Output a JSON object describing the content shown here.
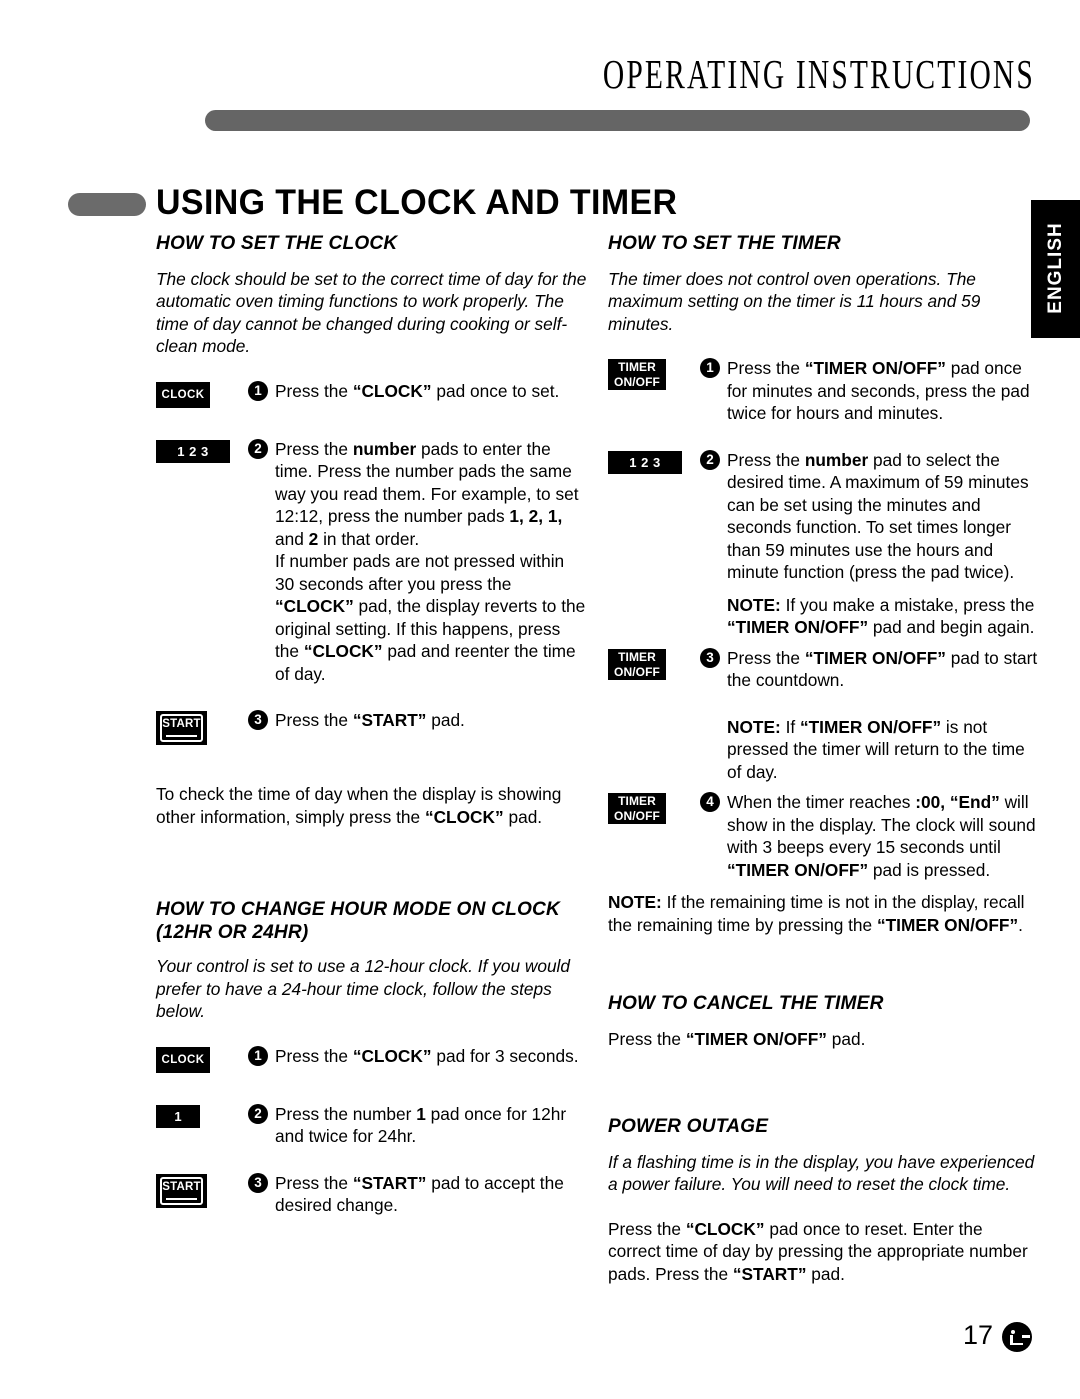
{
  "header": {
    "chapter_title": "OPERATING INSTRUCTIONS",
    "language_tab": "ENGLISH"
  },
  "section": {
    "title": "USING THE CLOCK AND TIMER"
  },
  "footer": {
    "page_number": "17",
    "logo": "lg-logo"
  },
  "left_column": {
    "clock": {
      "heading": "HOW TO SET THE CLOCK",
      "intro": "The clock should be set to the correct time of day for the automatic oven timing functions to work properly. The time of day cannot be changed during cooking or self-clean mode.",
      "steps": [
        {
          "pad": "CLOCK",
          "number": "1",
          "text_pre": "Press the ",
          "text_bold": "“CLOCK”",
          "text_post": " pad once to set."
        },
        {
          "pad": "1   2   3",
          "number": "2",
          "line1_pre": "Press the ",
          "line1_bold": "number",
          "line1_post": " pads to enter the time. Press the number pads the same way you read them. For example, to set 12:12, press the number pads ",
          "line1_bold2": "1, 2, 1,",
          "line1_post2": " and ",
          "line1_bold3": "2",
          "line1_post3": " in that order.",
          "line2_pre": "If number pads are not pressed within 30 seconds after you press the ",
          "line2_bold": "“CLOCK”",
          "line2_post": " pad, the display reverts to the original setting. If this happens, press the ",
          "line2_bold2": "“CLOCK”",
          "line2_post2": " pad and reenter the time of day."
        },
        {
          "pad": "START",
          "number": "3",
          "text_pre": "Press the ",
          "text_bold": "“START”",
          "text_post": " pad."
        }
      ],
      "check_time_pre": "To check the time of day when the display is showing other information, simply press the ",
      "check_time_bold": "“CLOCK”",
      "check_time_post": " pad."
    },
    "hour_mode": {
      "heading_line1": "HOW TO CHANGE HOUR MODE ON CLOCK",
      "heading_line2": "(12HR OR 24HR)",
      "intro": "Your control is set to use a 12-hour clock. If you would prefer to have a 24-hour time clock, follow the steps below.",
      "steps": [
        {
          "pad": "CLOCK",
          "number": "1",
          "text_pre": "Press the ",
          "text_bold": "“CLOCK”",
          "text_post": " pad for 3 seconds."
        },
        {
          "pad": "1",
          "number": "2",
          "text_pre": "Press the number ",
          "text_bold": "1",
          "text_post": " pad once for 12hr and twice for 24hr."
        },
        {
          "pad": "START",
          "number": "3",
          "text_pre": "Press the ",
          "text_bold": "“START”",
          "text_post": " pad to accept the desired change."
        }
      ]
    }
  },
  "right_column": {
    "timer": {
      "heading": "HOW TO SET THE TIMER",
      "intro": "The timer does not control oven operations. The maximum setting on the timer is 11 hours and 59 minutes.",
      "step1": {
        "pad_line1": "TIMER",
        "pad_line2": "ON/OFF",
        "number": "1",
        "text_pre": "Press the ",
        "text_bold": "“TIMER ON/OFF”",
        "text_post": " pad once for minutes and seconds, press the pad twice for hours and minutes."
      },
      "step2": {
        "pad": "1   2   3",
        "number": "2",
        "text_pre": "Press the ",
        "text_bold": "number",
        "text_post": " pad to select the desired time. A maximum of 59 minutes can be set using the minutes and seconds function. To set times longer than 59 minutes use the hours and minute function (press the pad twice)."
      },
      "note1_label": "NOTE:",
      "note1_pre": " If you make a mistake, press the ",
      "note1_bold": "“TIMER ON/OFF”",
      "note1_post": " pad and begin again.",
      "step3": {
        "pad_line1": "TIMER",
        "pad_line2": "ON/OFF",
        "number": "3",
        "text_pre": "Press the ",
        "text_bold": "“TIMER ON/OFF”",
        "text_post": " pad to start the countdown."
      },
      "note2_label": "NOTE:",
      "note2_pre": " If ",
      "note2_bold": "“TIMER ON/OFF”",
      "note2_post": " is not pressed the timer will return to the time of day.",
      "step4": {
        "pad_line1": "TIMER",
        "pad_line2": "ON/OFF",
        "number": "4",
        "text_pre": "When the timer reaches ",
        "text_bold": ":00, “End”",
        "text_mid": " will show in the display. The clock will sound with 3 beeps every 15 seconds until ",
        "text_bold2": "“TIMER ON/OFF”",
        "text_post": " pad is pressed."
      },
      "note3_label": "NOTE:",
      "note3_pre": " If the remaining time is not in the display, recall the remaining time by pressing the ",
      "note3_bold": "“TIMER ON/OFF”",
      "note3_post": "."
    },
    "cancel_timer": {
      "heading": "HOW TO CANCEL THE TIMER",
      "text_pre": "Press the ",
      "text_bold": "“TIMER ON/OFF”",
      "text_post": " pad."
    },
    "power_outage": {
      "heading": "POWER OUTAGE",
      "intro": "If a flashing time is in the display, you have experienced a power failure. You will need to reset the clock time.",
      "body_pre": "Press the ",
      "body_bold": "“CLOCK”",
      "body_mid": " pad once to reset. Enter the correct time of day by pressing the appropriate number pads. Press the ",
      "body_bold2": "“START”",
      "body_post": " pad."
    }
  }
}
